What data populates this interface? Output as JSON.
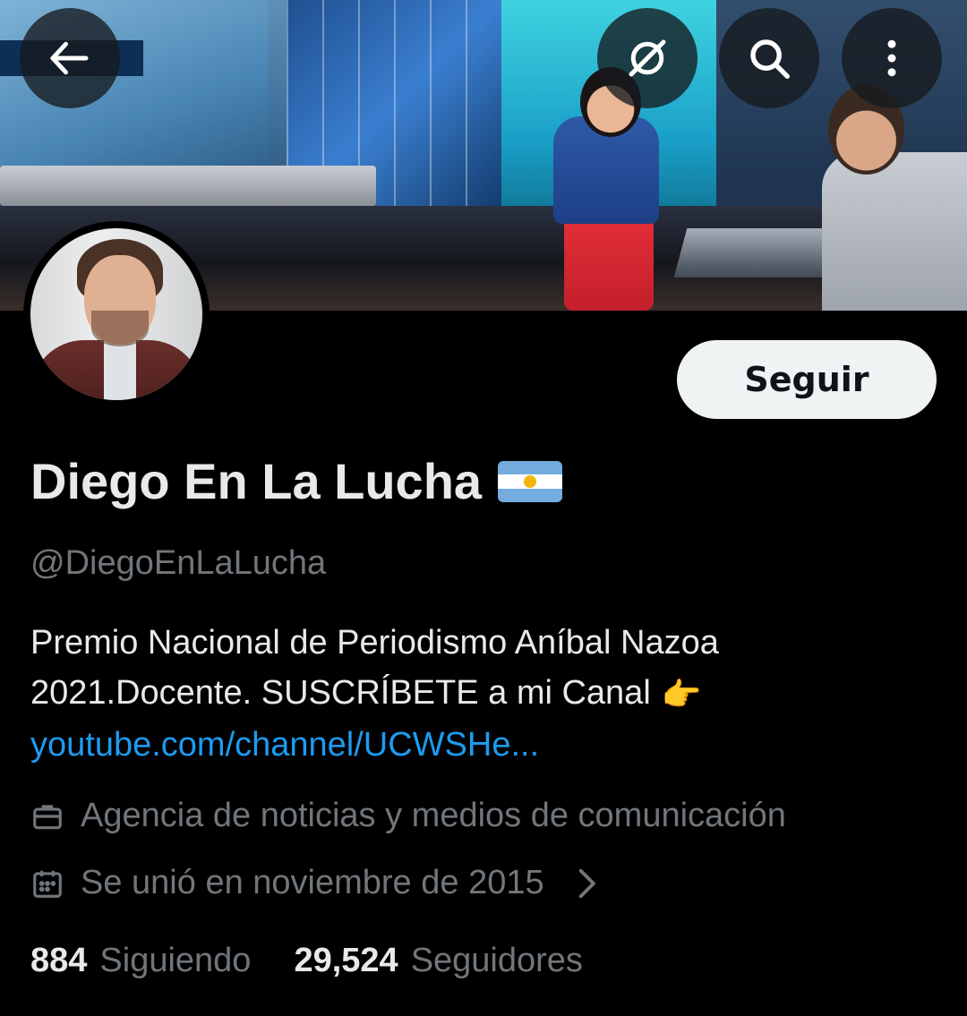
{
  "banner": {
    "description_icon": "banner-image"
  },
  "nav": {
    "back_icon": "arrow-left-icon",
    "grok_icon": "grok-icon",
    "search_icon": "search-icon",
    "more_icon": "more-vertical-icon"
  },
  "profile": {
    "display_name": "Diego En La Lucha",
    "flag_icon": "argentina-flag-icon",
    "handle": "@DiegoEnLaLucha",
    "follow_label": "Seguir",
    "bio_line1": "Premio Nacional de Periodismo Aníbal Nazoa",
    "bio_line2": "2021.Docente. SUSCRÍBETE a mi Canal",
    "bio_emoji": "👉",
    "bio_link": "youtube.com/channel/UCWSHe...",
    "category": "Agencia de noticias y medios de comunicación",
    "joined": "Se unió en noviembre de 2015",
    "following_count": "884",
    "following_label": "Siguiendo",
    "followers_count": "29,524",
    "followers_label": "Seguidores"
  },
  "colors": {
    "background": "#000000",
    "primary_text": "#e7e9ea",
    "secondary_text": "#71767b",
    "link": "#1d9bf0",
    "button_bg": "#eff3f4"
  }
}
